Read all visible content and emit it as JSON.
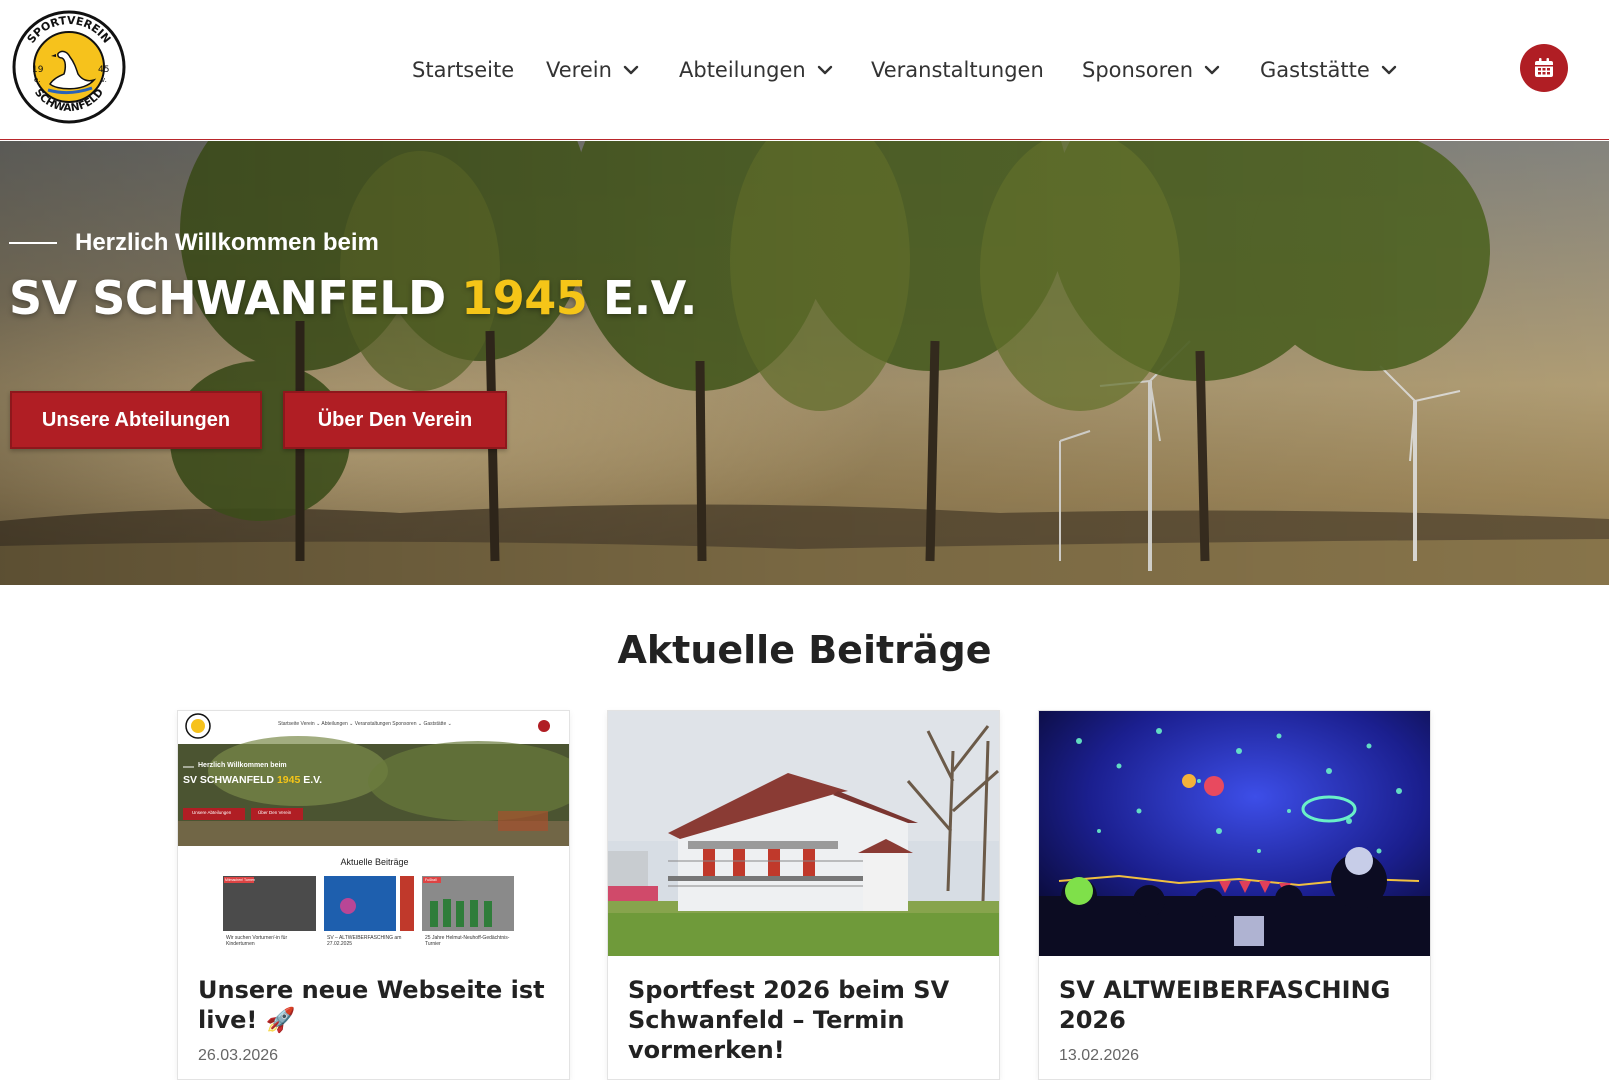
{
  "header": {
    "logo": {
      "top_text": "SPORTVEREIN",
      "bottom_text": "SCHWANFELD",
      "left_text": "19",
      "left_sub": "e.",
      "right_text": "45",
      "right_sub": "v."
    },
    "nav": [
      {
        "label": "Startseite",
        "has_dropdown": false
      },
      {
        "label": "Verein",
        "has_dropdown": true
      },
      {
        "label": "Abteilungen",
        "has_dropdown": true
      },
      {
        "label": "Veranstaltungen",
        "has_dropdown": false
      },
      {
        "label": "Sponsoren",
        "has_dropdown": true
      },
      {
        "label": "Gaststätte",
        "has_dropdown": true
      }
    ],
    "calendar_icon": "calendar-icon"
  },
  "hero": {
    "kicker": "Herzlich Willkommen beim",
    "title_main": "SV SCHWANFELD",
    "title_year": "1945",
    "title_suffix": "E.V.",
    "buttons": [
      "Unsere Abteilungen",
      "Über Den Verein"
    ]
  },
  "section": {
    "title": "Aktuelle Beiträge"
  },
  "posts": [
    {
      "title": "Unsere neue Webseite ist live! 🚀",
      "date": "26.03.2026",
      "mini": {
        "nav": "Startseite   Verein ⌄   Abteilungen ⌄   Veranstaltungen   Sponsoren ⌄   Gaststätte ⌄",
        "kicker": "Herzlich Willkommen beim",
        "title_main": "SV SCHWANFELD",
        "title_year": "1945",
        "title_suffix": "E.V.",
        "btn1": "Unsere Abteilungen",
        "btn2": "Über Den Verein",
        "section": "Aktuelle Beiträge",
        "cards": [
          "Wir suchen Vorturner/-in für Kinderturnen",
          "SV – ALTWEIBERFASCHING am 27.02.2025",
          "25 Jahre Helmut-Neuhoff-Gedächtnis-Turnier"
        ],
        "badge1": "Mitmachen! Turnen",
        "badge3": "Fußball"
      }
    },
    {
      "title": "Sportfest 2026 beim SV Schwanfeld – Termin vormerken!",
      "date": ""
    },
    {
      "title": "SV ALTWEIBERFASCHING 2026",
      "date": "13.02.2026"
    }
  ],
  "colors": {
    "brand_red": "#b01e24",
    "year_yellow": "#f5c518"
  }
}
